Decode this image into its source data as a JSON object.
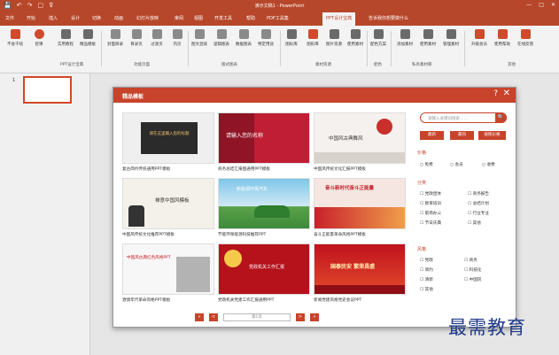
{
  "window": {
    "title": "演示文稿1 - PowerPoint",
    "quick_access": [
      "💾",
      "↶",
      "↷",
      "▢",
      "⊽"
    ],
    "controls": [
      "—",
      "□",
      "✕"
    ]
  },
  "tabs": [
    "文件",
    "开始",
    "插入",
    "设计",
    "切换",
    "动画",
    "幻灯片放映",
    "审阅",
    "视图",
    "开发工具",
    "帮助",
    "PDF工具集",
    "PPT设计宝典",
    "告诉我你想要做什么"
  ],
  "ribbon": {
    "buttons": [
      "不会干啥",
      "智课",
      "实用教程",
      "精品模板",
      "封面目录",
      "目录页",
      "过渡页",
      "内页",
      "图文混排",
      "逻辑图表",
      "数据图表",
      "特定用途",
      "图标库",
      "图形库",
      "图片资源",
      "使用素材",
      "配色方案",
      "添加素材",
      "使用素材",
      "管理素材",
      "升级会员",
      "使用帮助",
      "在线反馈"
    ],
    "groups": [
      "PPT设计宝典",
      "功能页面",
      "版式图表",
      "素材资源",
      "配色",
      "私有素材库",
      "其他"
    ]
  },
  "thumbs": {
    "number": "1"
  },
  "dialog": {
    "title": "精品模板",
    "help": "?",
    "close": "✕",
    "cards": [
      {
        "caption": "复古简约传统通用PPT模板",
        "img_title": "请在这里输入您的标题"
      },
      {
        "caption": "商务总结汇报图通用PPT模板",
        "img_title": "请输入您的名称"
      },
      {
        "caption": "中国风传统文化汇报PPT模板",
        "img_title": "中国风古典舞风"
      },
      {
        "caption": "中国风传统文化推荐PPT模板",
        "img_title": "禅意中国风模板"
      },
      {
        "caption": "节能环保能源科技推荐PPT",
        "img_title": "新能源环保汽车"
      },
      {
        "caption": "奋斗正能量革命风格PPT模板",
        "img_title": "奋斗新时代奋斗正能量"
      },
      {
        "caption": "激情年代革命风格PPT模板",
        "img_title": "中国风古典红色风格PPT"
      },
      {
        "caption": "党政机关党建工作汇报通用PPT",
        "img_title": "党政机关工作汇报"
      },
      {
        "caption": "新闻党建风格党史会议PPT",
        "img_title": "国泰民安 繁荣昌盛"
      }
    ],
    "pager": {
      "first": "«",
      "prev": "<",
      "page": "第1页",
      "next": ">",
      "last": "»"
    },
    "search_placeholder": "请输入关键词搜索……",
    "search_icon": "🔍",
    "filter_buttons": [
      "最新",
      "最热",
      "按照价格"
    ],
    "price": {
      "label": "价格",
      "options": [
        "免费",
        "会员",
        "收费"
      ]
    },
    "category": {
      "label": "分类",
      "options": [
        "党政团体",
        "商务报告",
        "教育培训",
        "总结计划",
        "职场办公",
        "行业专业",
        "节日庆典",
        "其他"
      ]
    },
    "style": {
      "label": "风格",
      "options": [
        "党政",
        "商务",
        "简约",
        "科技化",
        "清新",
        "中国风",
        "其他"
      ]
    }
  },
  "watermark": "最需教育"
}
